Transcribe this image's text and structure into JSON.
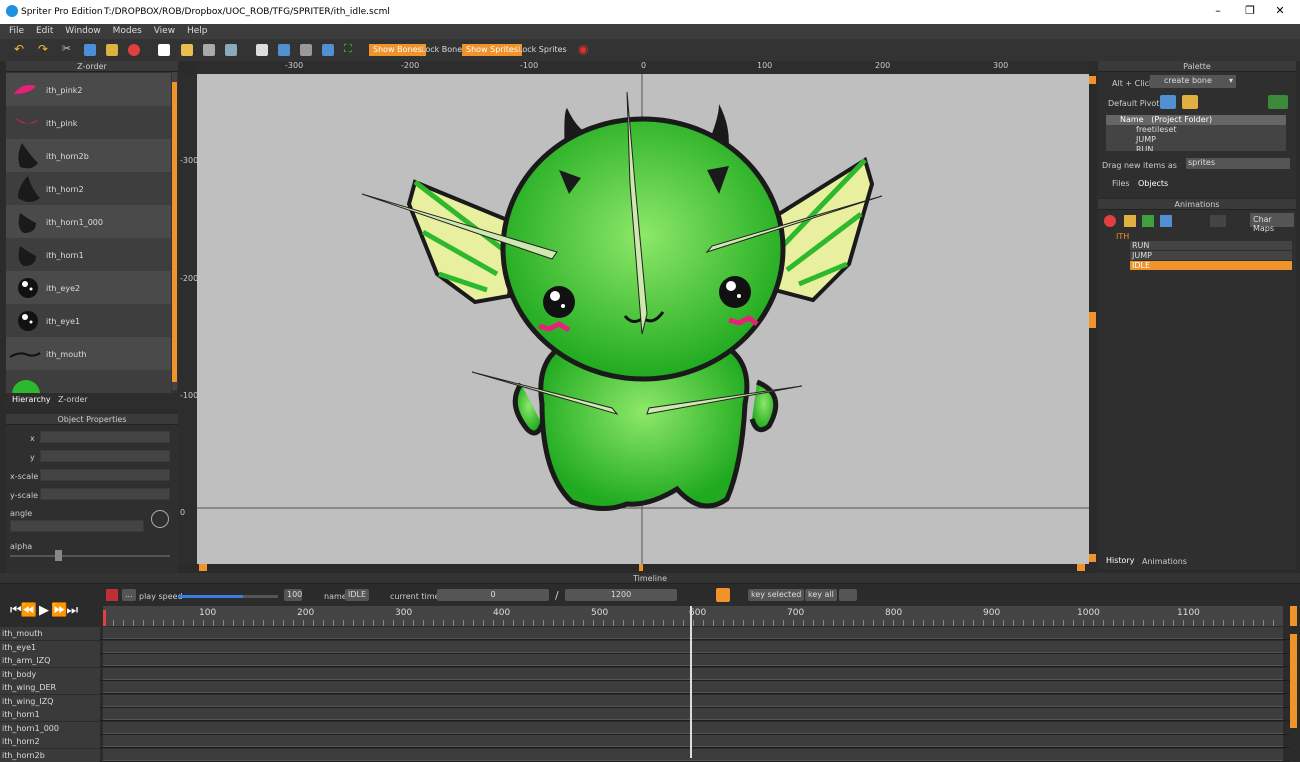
{
  "window": {
    "app_name": "Spriter Pro Edition",
    "file_path": "T:/DROPBOX/ROB/Dropbox/UOC_ROB/TFG/SPRITER/ith_idle.scml"
  },
  "menu": [
    "File",
    "Edit",
    "Window",
    "Modes",
    "View",
    "Help"
  ],
  "toolbar": {
    "show_bones": "Show Bones",
    "lock_bones": "Lock Bones",
    "show_sprites": "Show Sprites",
    "lock_sprites": "Lock Sprites"
  },
  "zorder": {
    "title": "Z-order",
    "items": [
      "ith_pink2",
      "ith_pink",
      "ith_horn2b",
      "ith_horn2",
      "ith_horn1_000",
      "ith_horn1",
      "ith_eye2",
      "ith_eye1",
      "ith_mouth"
    ],
    "tabs": [
      "Hierarchy",
      "Z-order"
    ]
  },
  "object_properties": {
    "title": "Object Properties",
    "labels": [
      "x",
      "y",
      "x-scale",
      "y-scale",
      "angle",
      "alpha"
    ]
  },
  "rulers": {
    "top": [
      "-300",
      "-200",
      "-100",
      "0",
      "100",
      "200",
      "300"
    ],
    "left": [
      "-300",
      "-200",
      "-100",
      "0"
    ]
  },
  "palette": {
    "title": "Palette",
    "alt_click_label": "Alt + Click:",
    "alt_click_value": "create bone",
    "default_pivot_label": "Default Pivot:",
    "tree_header_name": "Name",
    "tree_header_folder": "(Project Folder)",
    "folders": [
      "freetileset",
      "JUMP",
      "RUN"
    ],
    "drag_label": "Drag new items as",
    "drag_value": "sprites",
    "tabs": [
      "Files",
      "Objects"
    ]
  },
  "animations": {
    "title": "Animations",
    "char_maps": "Char Maps",
    "entity": "ITH",
    "list": [
      "RUN",
      "JUMP",
      "IDLE"
    ],
    "selected": "IDLE",
    "tabs": [
      "History",
      "Animations"
    ]
  },
  "timeline": {
    "title": "Timeline",
    "play_speed_label": "play speed",
    "play_speed_value": "100",
    "play_speed_level": 0.65,
    "name_label": "name",
    "name_value": "IDLE",
    "current_time_label": "current time:",
    "current_time": "0",
    "separator": "/",
    "total_time": "1200",
    "key_selected": "key selected",
    "key_all": "key all",
    "ticks": [
      "100",
      "200",
      "300",
      "400",
      "500",
      "600",
      "700",
      "800",
      "900",
      "1000",
      "1100"
    ],
    "tracks": [
      "ith_mouth",
      "ith_eye1",
      "ith_arm_IZQ",
      "ith_body",
      "ith_wing_DER",
      "ith_wing_IZQ",
      "ith_horn1",
      "ith_horn1_000",
      "ith_horn2",
      "ith_horn2b"
    ]
  },
  "colors": {
    "accent": "#f0932a",
    "canvas_bg": "#bfbfbf",
    "character_green": "#2eb82e",
    "wing_yellow": "#e8f0a0"
  }
}
